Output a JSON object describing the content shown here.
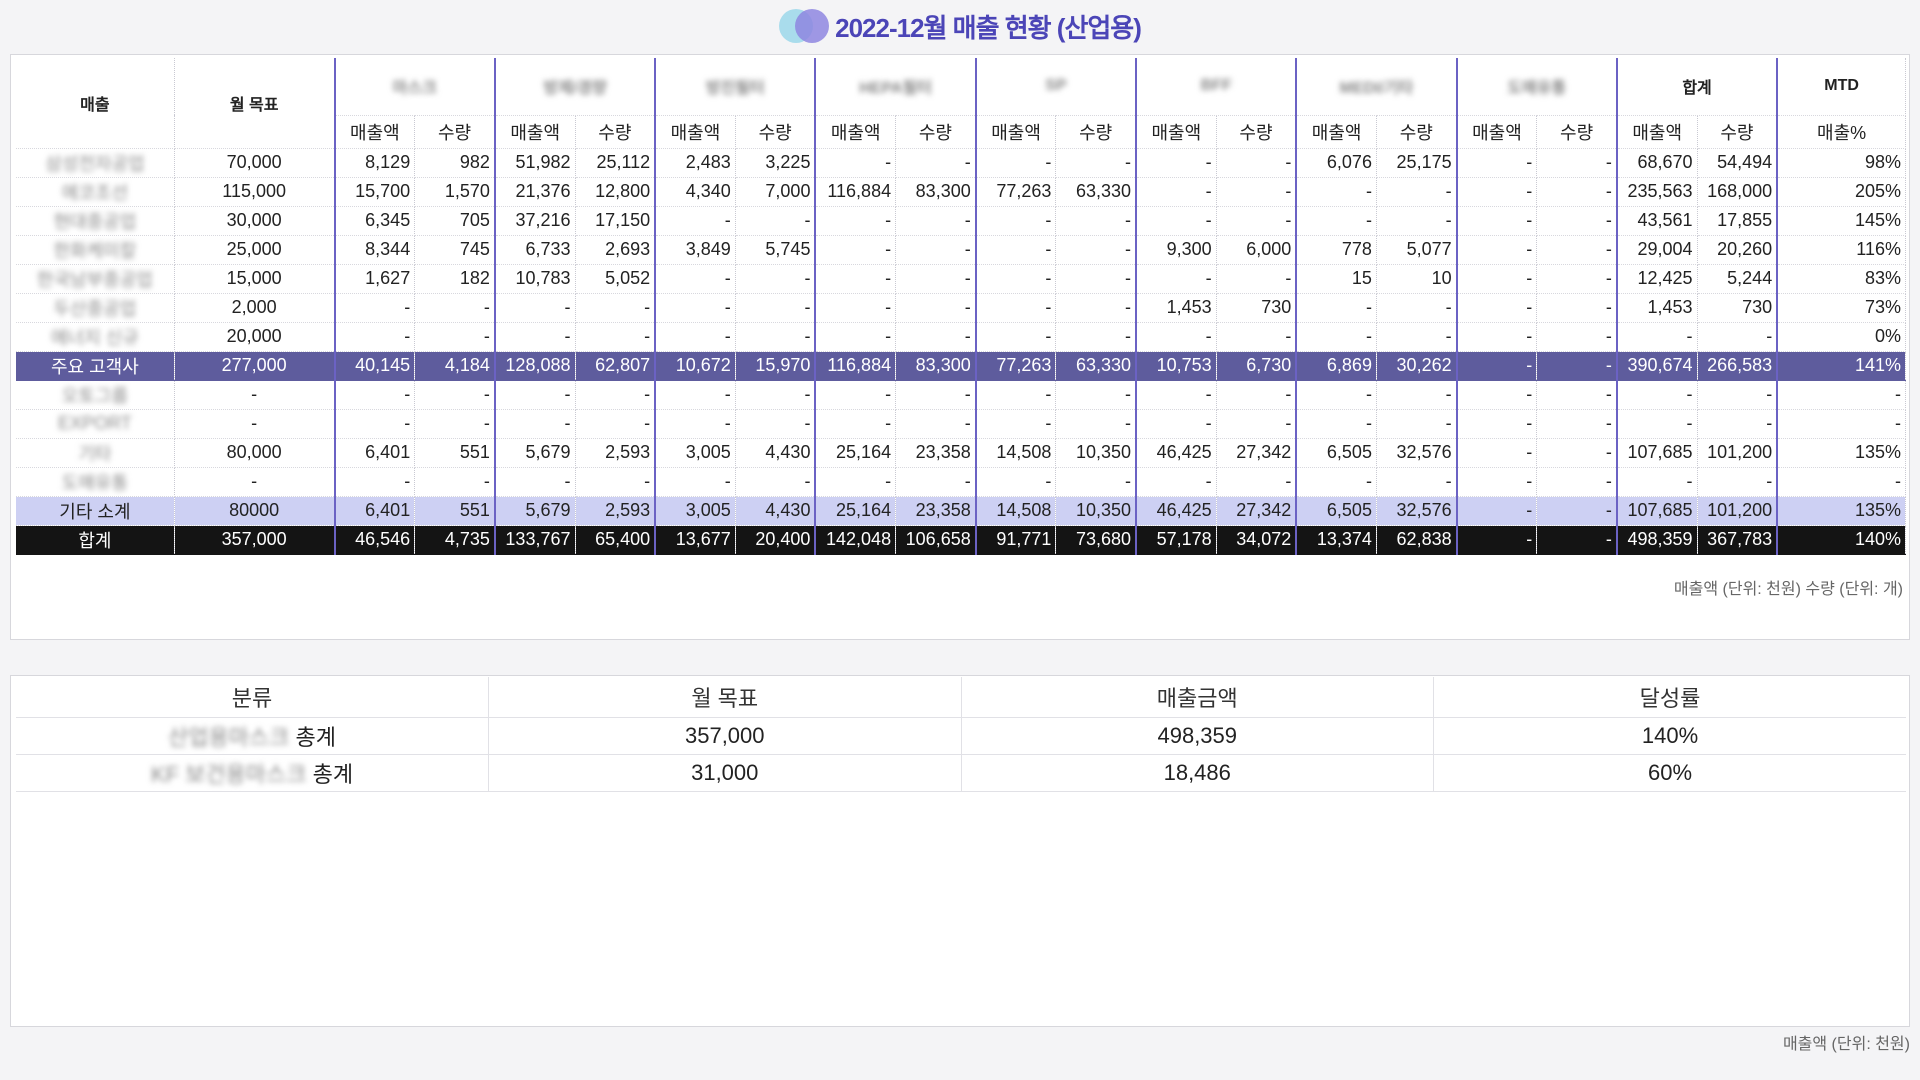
{
  "title": "2022-12월 매출 현황 (산업용)",
  "colors": {
    "accent": "#4b45b7",
    "major_row": "#5e5c9d",
    "etc_row": "#cdd0f3",
    "total_row": "#141414"
  },
  "sales_table": {
    "header": {
      "col1": "매출",
      "col2": "월 목표",
      "groups": [
        "마스크",
        "방제/경량",
        "방진필터",
        "HEPA필터",
        "SP",
        "BFF",
        "MEDI/기타",
        "도매유통"
      ],
      "sum_label": "합계",
      "mtd_label": "MTD",
      "sub_amount": "매출액",
      "sub_qty": "수량",
      "sub_pct": "매출%"
    },
    "rows": [
      {
        "name": "삼성전자공업",
        "target": "70,000",
        "vals": [
          "8,129",
          "982",
          "51,982",
          "25,112",
          "2,483",
          "3,225",
          "-",
          "-",
          "-",
          "-",
          "-",
          "-",
          "6,076",
          "25,175",
          "-",
          "-"
        ],
        "sum": [
          "68,670",
          "54,494"
        ],
        "mtd": "98%"
      },
      {
        "name": "에코조선",
        "target": "115,000",
        "vals": [
          "15,700",
          "1,570",
          "21,376",
          "12,800",
          "4,340",
          "7,000",
          "116,884",
          "83,300",
          "77,263",
          "63,330",
          "-",
          "-",
          "-",
          "-",
          "-",
          "-"
        ],
        "sum": [
          "235,563",
          "168,000"
        ],
        "mtd": "205%"
      },
      {
        "name": "현대중공업",
        "target": "30,000",
        "vals": [
          "6,345",
          "705",
          "37,216",
          "17,150",
          "-",
          "-",
          "-",
          "-",
          "-",
          "-",
          "-",
          "-",
          "-",
          "-",
          "-",
          "-"
        ],
        "sum": [
          "43,561",
          "17,855"
        ],
        "mtd": "145%"
      },
      {
        "name": "한화케미칼",
        "target": "25,000",
        "vals": [
          "8,344",
          "745",
          "6,733",
          "2,693",
          "3,849",
          "5,745",
          "-",
          "-",
          "-",
          "-",
          "9,300",
          "6,000",
          "778",
          "5,077",
          "-",
          "-"
        ],
        "sum": [
          "29,004",
          "20,260"
        ],
        "mtd": "116%"
      },
      {
        "name": "한국남부중공업",
        "target": "15,000",
        "vals": [
          "1,627",
          "182",
          "10,783",
          "5,052",
          "-",
          "-",
          "-",
          "-",
          "-",
          "-",
          "-",
          "-",
          "15",
          "10",
          "-",
          "-"
        ],
        "sum": [
          "12,425",
          "5,244"
        ],
        "mtd": "83%"
      },
      {
        "name": "두산중공업",
        "target": "2,000",
        "vals": [
          "-",
          "-",
          "-",
          "-",
          "-",
          "-",
          "-",
          "-",
          "-",
          "-",
          "1,453",
          "730",
          "-",
          "-",
          "-",
          "-"
        ],
        "sum": [
          "1,453",
          "730"
        ],
        "mtd": "73%"
      },
      {
        "name": "에너지 신규",
        "target": "20,000",
        "vals": [
          "-",
          "-",
          "-",
          "-",
          "-",
          "-",
          "-",
          "-",
          "-",
          "-",
          "-",
          "-",
          "-",
          "-",
          "-",
          "-"
        ],
        "sum": [
          "-",
          "-"
        ],
        "mtd": "0%"
      }
    ],
    "major": {
      "name": "주요 고객사",
      "target": "277,000",
      "vals": [
        "40,145",
        "4,184",
        "128,088",
        "62,807",
        "10,672",
        "15,970",
        "116,884",
        "83,300",
        "77,263",
        "63,330",
        "10,753",
        "6,730",
        "6,869",
        "30,262",
        "-",
        "-"
      ],
      "sum": [
        "390,674",
        "266,583"
      ],
      "mtd": "141%"
    },
    "others": [
      {
        "name": "오토그룹",
        "target": "-",
        "vals": [
          "-",
          "-",
          "-",
          "-",
          "-",
          "-",
          "-",
          "-",
          "-",
          "-",
          "-",
          "-",
          "-",
          "-",
          "-",
          "-"
        ],
        "sum": [
          "-",
          "-"
        ],
        "mtd": "-"
      },
      {
        "name": "EXPORT",
        "target": "-",
        "vals": [
          "-",
          "-",
          "-",
          "-",
          "-",
          "-",
          "-",
          "-",
          "-",
          "-",
          "-",
          "-",
          "-",
          "-",
          "-",
          "-"
        ],
        "sum": [
          "-",
          "-"
        ],
        "mtd": "-"
      },
      {
        "name": "기타",
        "target": "80,000",
        "vals": [
          "6,401",
          "551",
          "5,679",
          "2,593",
          "3,005",
          "4,430",
          "25,164",
          "23,358",
          "14,508",
          "10,350",
          "46,425",
          "27,342",
          "6,505",
          "32,576",
          "-",
          "-"
        ],
        "sum": [
          "107,685",
          "101,200"
        ],
        "mtd": "135%"
      },
      {
        "name": "도매유통",
        "target": "-",
        "vals": [
          "-",
          "-",
          "-",
          "-",
          "-",
          "-",
          "-",
          "-",
          "-",
          "-",
          "-",
          "-",
          "-",
          "-",
          "-",
          "-"
        ],
        "sum": [
          "-",
          "-"
        ],
        "mtd": "-"
      }
    ],
    "etc_subtotal": {
      "name": "기타 소계",
      "target": "80000",
      "vals": [
        "6,401",
        "551",
        "5,679",
        "2,593",
        "3,005",
        "4,430",
        "25,164",
        "23,358",
        "14,508",
        "10,350",
        "46,425",
        "27,342",
        "6,505",
        "32,576",
        "-",
        "-"
      ],
      "sum": [
        "107,685",
        "101,200"
      ],
      "mtd": "135%"
    },
    "total": {
      "name": "합계",
      "target": "357,000",
      "vals": [
        "46,546",
        "4,735",
        "133,767",
        "65,400",
        "13,677",
        "20,400",
        "142,048",
        "106,658",
        "91,771",
        "73,680",
        "57,178",
        "34,072",
        "13,374",
        "62,838",
        "-",
        "-"
      ],
      "sum": [
        "498,359",
        "367,783"
      ],
      "mtd": "140%"
    },
    "unit_note": "매출액 (단위: 천원) 수량 (단위: 개)"
  },
  "summary_table": {
    "headers": [
      "분류",
      "월 목표",
      "매출금액",
      "달성률"
    ],
    "rows": [
      {
        "prefix": "산업용마스크",
        "suffix": " 총계",
        "target": "357,000",
        "sales": "498,359",
        "rate": "140%"
      },
      {
        "prefix": "KF 보건용마스크",
        "suffix": " 총계",
        "target": "31,000",
        "sales": "18,486",
        "rate": "60%"
      }
    ],
    "unit_note": "매출액 (단위: 천원)"
  }
}
